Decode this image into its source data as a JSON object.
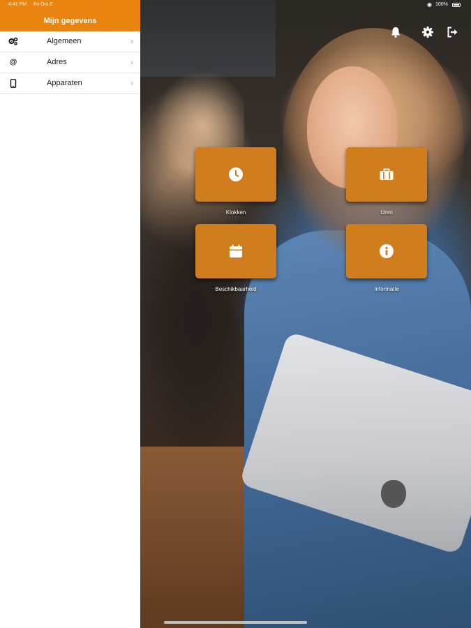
{
  "status_bar": {
    "time": "4:41 PM",
    "date": "Fri Oct 8",
    "battery": "100%"
  },
  "sidebar": {
    "title": "Mijn gegevens",
    "items": [
      {
        "label": "Algemeen",
        "icon": "gears-icon"
      },
      {
        "label": "Adres",
        "icon": "at-icon"
      },
      {
        "label": "Apparaten",
        "icon": "tablet-icon"
      }
    ]
  },
  "toolbar": {
    "icons": [
      "bell-icon",
      "gear-icon",
      "logout-icon"
    ]
  },
  "tiles": [
    {
      "label": "Klokken",
      "icon": "clock-icon"
    },
    {
      "label": "Uren",
      "icon": "briefcase-icon"
    },
    {
      "label": "Beschikbaarheid",
      "icon": "calendar-icon"
    },
    {
      "label": "Informatie",
      "icon": "info-icon"
    }
  ],
  "colors": {
    "accent": "#e8840f",
    "tile": "#d07d1e"
  }
}
